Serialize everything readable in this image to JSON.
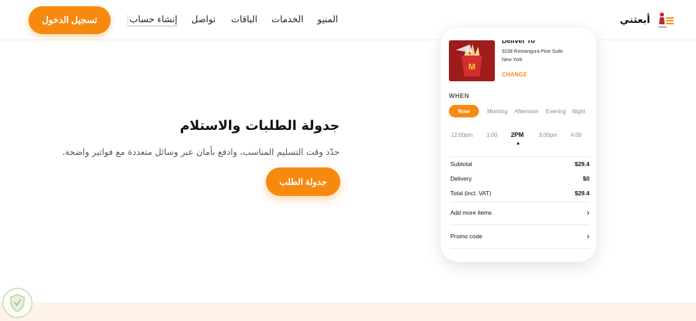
{
  "header": {
    "logo_text": "أبعثني",
    "login_button": "تسجيل الدخول",
    "nav": {
      "menu": "المنيو",
      "services": "الخدمات",
      "packages": "الباقات",
      "contact": "تواصل",
      "create_account": "إنشاء حساب"
    }
  },
  "hero": {
    "title": "جدولة الطلبات والاستلام",
    "description": "حدّد وقت التسليم المناسب، وادفع بأمان عبر وسائل متعددة مع فواتير واضحة.",
    "schedule_button": "جدولة الطلب"
  },
  "card": {
    "deliver_to": "Deliver To",
    "address_line1": "9238 Romangura Pine Suite",
    "address_line2": "New York",
    "change": "CHANGE",
    "when": "WHEN",
    "time_tabs": [
      {
        "label": "Now",
        "active": true
      },
      {
        "label": "Morning",
        "active": false
      },
      {
        "label": "Afternoon",
        "active": false
      },
      {
        "label": "Evening",
        "active": false
      },
      {
        "label": "Night",
        "active": false
      }
    ],
    "hours": [
      {
        "label": "12:00pm",
        "active": false
      },
      {
        "label": "1:00",
        "active": false
      },
      {
        "label": "2PM",
        "active": true
      },
      {
        "label": "3:00pm",
        "active": false
      },
      {
        "label": "4:00",
        "active": false
      }
    ],
    "selected_marker": "▲",
    "summary": {
      "subtotal_label": "Subtotal",
      "subtotal_value": "$29.4",
      "delivery_label": "Delivery",
      "delivery_value": "$0",
      "total_label": "Total (incl. VAT)",
      "total_value": "$29.4"
    },
    "add_more": "Add more items",
    "promo": "Promo code"
  },
  "colors": {
    "accent": "#f7890f",
    "strip": "#fdf3e8",
    "food_bg": "#9e1c1c"
  }
}
